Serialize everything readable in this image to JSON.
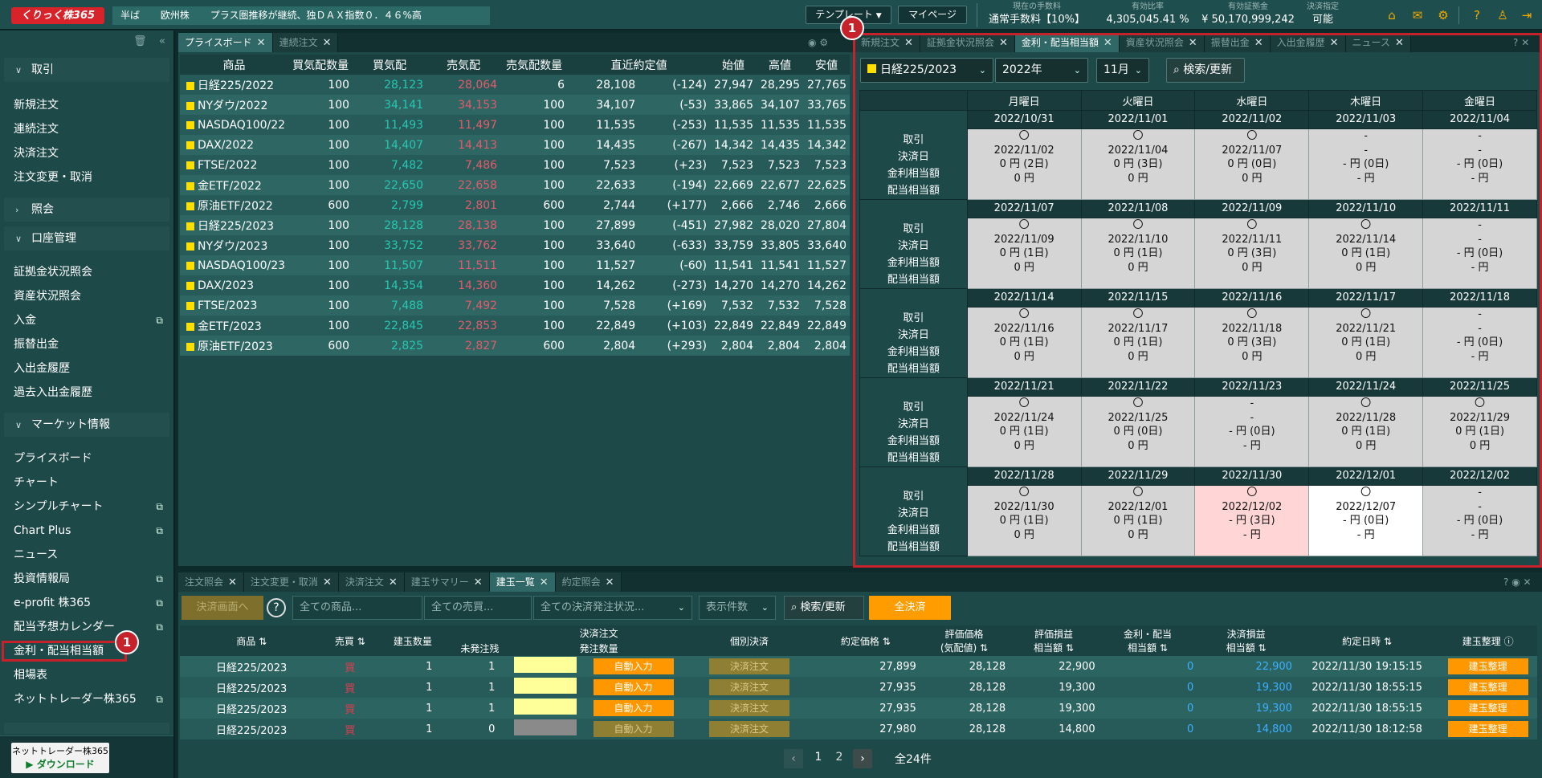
{
  "app": {
    "logo": "くりっく株365"
  },
  "ticker": [
    "半ば",
    "欧州株",
    "プラス圏推移が継続、独ＤＡＸ指数０．４６%高"
  ],
  "header": {
    "template_label": "テンプレート",
    "mypage_label": "マイページ",
    "summaries": [
      {
        "label": "現在の手数料",
        "value": "通常手数料【10%】"
      },
      {
        "label": "有効比率",
        "value": "4,305,045.41 %"
      },
      {
        "label": "有効証拠金",
        "value": "¥ 50,170,999,242"
      },
      {
        "label": "決済指定",
        "value": "可能"
      }
    ],
    "icons": [
      "home-icon",
      "mail-icon",
      "gear-icon",
      "help-icon",
      "user-icon",
      "logout-icon"
    ]
  },
  "sidebar": {
    "sections": [
      {
        "label": "取引",
        "expanded": true,
        "items": [
          {
            "label": "新規注文",
            "ext": false
          },
          {
            "label": "連続注文",
            "ext": false
          },
          {
            "label": "決済注文",
            "ext": false
          },
          {
            "label": "注文変更・取消",
            "ext": false
          }
        ]
      },
      {
        "label": "照会",
        "expanded": false,
        "items": []
      },
      {
        "label": "口座管理",
        "expanded": true,
        "items": [
          {
            "label": "証拠金状況照会",
            "ext": false
          },
          {
            "label": "資産状況照会",
            "ext": false
          },
          {
            "label": "入金",
            "ext": true
          },
          {
            "label": "振替出金",
            "ext": false
          },
          {
            "label": "入出金履歴",
            "ext": false
          },
          {
            "label": "過去入出金履歴",
            "ext": false
          }
        ]
      },
      {
        "label": "マーケット情報",
        "expanded": true,
        "items": [
          {
            "label": "プライスボード",
            "ext": false
          },
          {
            "label": "チャート",
            "ext": false
          },
          {
            "label": "シンプルチャート",
            "ext": true
          },
          {
            "label": "Chart Plus",
            "ext": true
          },
          {
            "label": "ニュース",
            "ext": false
          },
          {
            "label": "投資情報局",
            "ext": true
          },
          {
            "label": "e-profit 株365",
            "ext": true
          },
          {
            "label": "配当予想カレンダー",
            "ext": true
          },
          {
            "label": "金利・配当相当額",
            "ext": false
          },
          {
            "label": "相場表",
            "ext": false
          },
          {
            "label": "ネットトレーダー株365",
            "ext": true
          }
        ]
      }
    ],
    "download": {
      "line1": "ネットトレーダー株365",
      "line2": "ダウンロード"
    }
  },
  "priceboard": {
    "tabs": [
      "プライスボード",
      "連続注文"
    ],
    "columns": [
      "商品",
      "買気配数量",
      "買気配",
      "売気配",
      "売気配数量",
      "直近約定値",
      "始値",
      "高値",
      "安値"
    ],
    "rows": [
      [
        "日経225/2022",
        "100",
        "28,123",
        "28,064",
        "6",
        "28,108",
        "(-124)",
        "27,947",
        "28,295",
        "27,765"
      ],
      [
        "NYダウ/2022",
        "100",
        "34,141",
        "34,153",
        "100",
        "34,107",
        "(-53)",
        "33,865",
        "34,107",
        "33,765"
      ],
      [
        "NASDAQ100/22",
        "100",
        "11,493",
        "11,497",
        "100",
        "11,535",
        "(-253)",
        "11,535",
        "11,535",
        "11,535"
      ],
      [
        "DAX/2022",
        "100",
        "14,407",
        "14,413",
        "100",
        "14,435",
        "(-267)",
        "14,342",
        "14,435",
        "14,342"
      ],
      [
        "FTSE/2022",
        "100",
        "7,482",
        "7,486",
        "100",
        "7,523",
        "(+23)",
        "7,523",
        "7,523",
        "7,523"
      ],
      [
        "金ETF/2022",
        "100",
        "22,650",
        "22,658",
        "100",
        "22,633",
        "(-194)",
        "22,669",
        "22,677",
        "22,625"
      ],
      [
        "原油ETF/2022",
        "600",
        "2,799",
        "2,801",
        "600",
        "2,744",
        "(+177)",
        "2,666",
        "2,746",
        "2,666"
      ],
      [
        "日経225/2023",
        "100",
        "28,128",
        "28,138",
        "100",
        "27,899",
        "(-451)",
        "27,982",
        "28,020",
        "27,804"
      ],
      [
        "NYダウ/2023",
        "100",
        "33,752",
        "33,762",
        "100",
        "33,640",
        "(-633)",
        "33,759",
        "33,805",
        "33,640"
      ],
      [
        "NASDAQ100/23",
        "100",
        "11,507",
        "11,511",
        "100",
        "11,527",
        "(-60)",
        "11,541",
        "11,541",
        "11,527"
      ],
      [
        "DAX/2023",
        "100",
        "14,354",
        "14,360",
        "100",
        "14,262",
        "(-273)",
        "14,270",
        "14,270",
        "14,262"
      ],
      [
        "FTSE/2023",
        "100",
        "7,488",
        "7,492",
        "100",
        "7,528",
        "(+169)",
        "7,532",
        "7,532",
        "7,528"
      ],
      [
        "金ETF/2023",
        "100",
        "22,845",
        "22,853",
        "100",
        "22,849",
        "(+103)",
        "22,849",
        "22,849",
        "22,849"
      ],
      [
        "原油ETF/2023",
        "600",
        "2,825",
        "2,827",
        "600",
        "2,804",
        "(+293)",
        "2,804",
        "2,804",
        "2,804"
      ]
    ]
  },
  "calendar": {
    "tabs": [
      "新規注文",
      "証拠金状況照会",
      "金利・配当相当額",
      "資産状況照会",
      "振替出金",
      "入出金履歴",
      "ニュース"
    ],
    "active_tab": 2,
    "product": "日経225/2023",
    "year": "2022年",
    "month": "11月",
    "search_label": "検索/更新",
    "weekdays": [
      "月曜日",
      "火曜日",
      "水曜日",
      "木曜日",
      "金曜日"
    ],
    "row_labels": [
      "取引",
      "決済日",
      "金利相当額",
      "配当相当額"
    ],
    "weeks": [
      [
        {
          "date": "2022/11/01",
          "trade": "〇",
          "settle": "2022/11/04",
          "interest": "0 円 (3日)",
          "dividend": "0 円"
        },
        {
          "date": "2022/11/02",
          "trade": "〇",
          "settle": "2022/11/07",
          "interest": "0 円 (0日)",
          "dividend": "0 円"
        },
        {
          "date": "2022/11/03",
          "trade": "-",
          "settle": "-",
          "interest": "- 円 (0日)",
          "dividend": "- 円"
        },
        {
          "date": "2022/11/04",
          "trade": "-",
          "settle": "-",
          "interest": "- 円 (0日)",
          "dividend": "- 円"
        }
      ],
      [
        {
          "date": "2022/11/07",
          "trade": "〇",
          "settle": "2022/11/09",
          "interest": "0 円 (1日)",
          "dividend": "0 円"
        },
        {
          "date": "2022/11/08",
          "trade": "〇",
          "settle": "2022/11/10",
          "interest": "0 円 (1日)",
          "dividend": "0 円"
        },
        {
          "date": "2022/11/09",
          "trade": "〇",
          "settle": "2022/11/11",
          "interest": "0 円 (3日)",
          "dividend": "0 円"
        },
        {
          "date": "2022/11/10",
          "trade": "〇",
          "settle": "2022/11/14",
          "interest": "0 円 (1日)",
          "dividend": "0 円"
        },
        {
          "date": "2022/11/11",
          "trade": "-",
          "settle": "-",
          "interest": "- 円 (0日)",
          "dividend": "- 円"
        }
      ],
      [
        {
          "date": "2022/11/14",
          "trade": "〇",
          "settle": "2022/11/16",
          "interest": "0 円 (1日)",
          "dividend": "0 円"
        },
        {
          "date": "2022/11/15",
          "trade": "〇",
          "settle": "2022/11/17",
          "interest": "0 円 (1日)",
          "dividend": "0 円"
        },
        {
          "date": "2022/11/16",
          "trade": "〇",
          "settle": "2022/11/18",
          "interest": "0 円 (3日)",
          "dividend": "0 円"
        },
        {
          "date": "2022/11/17",
          "trade": "〇",
          "settle": "2022/11/21",
          "interest": "0 円 (1日)",
          "dividend": "0 円"
        },
        {
          "date": "2022/11/18",
          "trade": "-",
          "settle": "-",
          "interest": "- 円 (0日)",
          "dividend": "- 円"
        }
      ],
      [
        {
          "date": "2022/11/21",
          "trade": "〇",
          "settle": "2022/11/24",
          "interest": "0 円 (1日)",
          "dividend": "0 円"
        },
        {
          "date": "2022/11/22",
          "trade": "〇",
          "settle": "2022/11/25",
          "interest": "0 円 (0日)",
          "dividend": "0 円"
        },
        {
          "date": "2022/11/23",
          "trade": "-",
          "settle": "-",
          "interest": "- 円 (0日)",
          "dividend": "- 円"
        },
        {
          "date": "2022/11/24",
          "trade": "〇",
          "settle": "2022/11/28",
          "interest": "0 円 (1日)",
          "dividend": "0 円"
        },
        {
          "date": "2022/11/25",
          "trade": "〇",
          "settle": "2022/11/29",
          "interest": "0 円 (1日)",
          "dividend": "0 円"
        }
      ],
      [
        {
          "date": "2022/11/28",
          "trade": "〇",
          "settle": "2022/11/30",
          "interest": "0 円 (1日)",
          "dividend": "0 円"
        },
        {
          "date": "2022/11/29",
          "trade": "〇",
          "settle": "2022/12/01",
          "interest": "0 円 (1日)",
          "dividend": "0 円"
        },
        {
          "date": "2022/11/30",
          "trade": "〇",
          "settle": "2022/12/02",
          "interest": "- 円 (3日)",
          "dividend": "- 円",
          "highlight": "pink"
        },
        {
          "date": "2022/12/01",
          "trade": "〇",
          "settle": "2022/12/07",
          "interest": "- 円 (0日)",
          "dividend": "- 円",
          "highlight": "white"
        },
        {
          "date": "2022/12/02",
          "trade": "-",
          "settle": "-",
          "interest": "- 円 (0日)",
          "dividend": "- 円"
        }
      ]
    ],
    "week1_monday": {
      "date": "2022/10/31",
      "trade": "〇",
      "settle": "2022/11/02",
      "interest": "0 円 (2日)",
      "dividend": "0 円"
    }
  },
  "positions": {
    "tabs": [
      "注文照会",
      "注文変更・取消",
      "決済注文",
      "建玉サマリー",
      "建玉一覧",
      "約定照会"
    ],
    "active_tab": 4,
    "toolbar": {
      "settle_screen": "決済画面へ",
      "product_filter": "全ての商品...",
      "side_filter": "全ての売買...",
      "status_filter": "全ての決済発注状況...",
      "count_filter": "表示件数",
      "search": "検索/更新",
      "settle_all": "全決済"
    },
    "headers": {
      "product": "商品",
      "side": "売買",
      "qty": "建玉数量",
      "unfilled": "未発注残",
      "settle_order": "決済注文",
      "order_qty": "発注数量",
      "individual": "個別決済",
      "price": "約定価格",
      "eval1": "評価価格",
      "eval2": "(気配値)",
      "pnl1": "評価損益",
      "pnl2": "相当額",
      "int1": "金利・配当",
      "int2": "相当額",
      "spnl1": "決済損益",
      "spnl2": "相当額",
      "datetime": "約定日時",
      "manage": "建玉整理"
    },
    "rows": [
      {
        "product": "日経225/2023",
        "side": "買",
        "qty": "1",
        "unfilled": "1",
        "auto": "自動入力",
        "settle": "決済注文",
        "price": "27,899",
        "eval": "28,128",
        "pnl": "22,900",
        "interest": "0",
        "spnl": "22,900",
        "datetime": "2022/11/30 19:15:15",
        "manage": "建玉整理"
      },
      {
        "product": "日経225/2023",
        "side": "買",
        "qty": "1",
        "unfilled": "1",
        "auto": "自動入力",
        "settle": "決済注文",
        "price": "27,935",
        "eval": "28,128",
        "pnl": "19,300",
        "interest": "0",
        "spnl": "19,300",
        "datetime": "2022/11/30 18:55:15",
        "manage": "建玉整理"
      },
      {
        "product": "日経225/2023",
        "side": "買",
        "qty": "1",
        "unfilled": "1",
        "auto": "自動入力",
        "settle": "決済注文",
        "price": "27,935",
        "eval": "28,128",
        "pnl": "19,300",
        "interest": "0",
        "spnl": "19,300",
        "datetime": "2022/11/30 18:55:15",
        "manage": "建玉整理"
      },
      {
        "product": "日経225/2023",
        "side": "買",
        "qty": "1",
        "unfilled": "0",
        "auto": "自動入力",
        "settle": "決済注文",
        "price": "27,980",
        "eval": "28,128",
        "pnl": "14,800",
        "interest": "0",
        "spnl": "14,800",
        "datetime": "2022/11/30 18:12:58",
        "manage": "建玉整理"
      }
    ],
    "pager": {
      "page1": "1",
      "page2": "2",
      "total": "全24件"
    }
  },
  "annotations": {
    "badge": "1"
  }
}
